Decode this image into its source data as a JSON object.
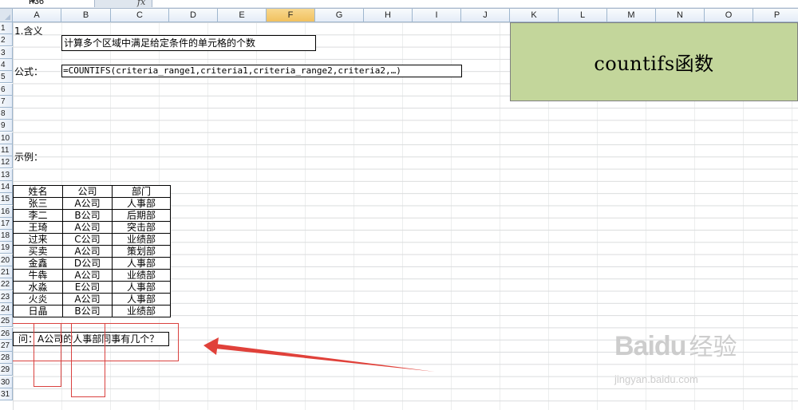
{
  "formula_bar": {
    "name_box": "F36",
    "fx_icon": "fx-icon",
    "formula": ""
  },
  "columns": [
    "A",
    "B",
    "C",
    "D",
    "E",
    "F",
    "G",
    "H",
    "I",
    "J",
    "K",
    "L",
    "M",
    "N",
    "O",
    "P"
  ],
  "selected_column": "F",
  "rows": [
    "1",
    "2",
    "3",
    "4",
    "5",
    "6",
    "7",
    "8",
    "9",
    "10",
    "11",
    "12",
    "13",
    "14",
    "15",
    "16",
    "17",
    "18",
    "19",
    "20",
    "21",
    "22",
    "23",
    "24",
    "25",
    "26",
    "27",
    "28",
    "29",
    "30",
    "31"
  ],
  "cells": {
    "heading": "1.含义",
    "definition": "计算多个区域中满足给定条件的单元格的个数",
    "formula_label": "公式：",
    "formula_syntax": "=COUNTIFS(criteria_range1,criteria1,criteria_range2,criteria2,…)",
    "example_label": "示例：",
    "question": "问：A公司的人事部同事有几个？"
  },
  "title_box": "countifs函数",
  "example_table": {
    "headers": [
      "姓名",
      "公司",
      "部门"
    ],
    "rows": [
      [
        "张三",
        "A公司",
        "人事部"
      ],
      [
        "李二",
        "B公司",
        "后期部"
      ],
      [
        "王琦",
        "A公司",
        "突击部"
      ],
      [
        "过来",
        "C公司",
        "业绩部"
      ],
      [
        "买卖",
        "A公司",
        "策划部"
      ],
      [
        "金鑫",
        "D公司",
        "人事部"
      ],
      [
        "牛犇",
        "A公司",
        "业绩部"
      ],
      [
        "水淼",
        "E公司",
        "人事部"
      ],
      [
        "火炎",
        "A公司",
        "人事部"
      ],
      [
        "日晶",
        "B公司",
        "业绩部"
      ]
    ]
  },
  "annotation_color": "#d9413f",
  "title_box_color": "#c3d69b",
  "watermark": {
    "brand": "Baidu",
    "sub": "经验",
    "url": "jingyan.baidu.com"
  }
}
